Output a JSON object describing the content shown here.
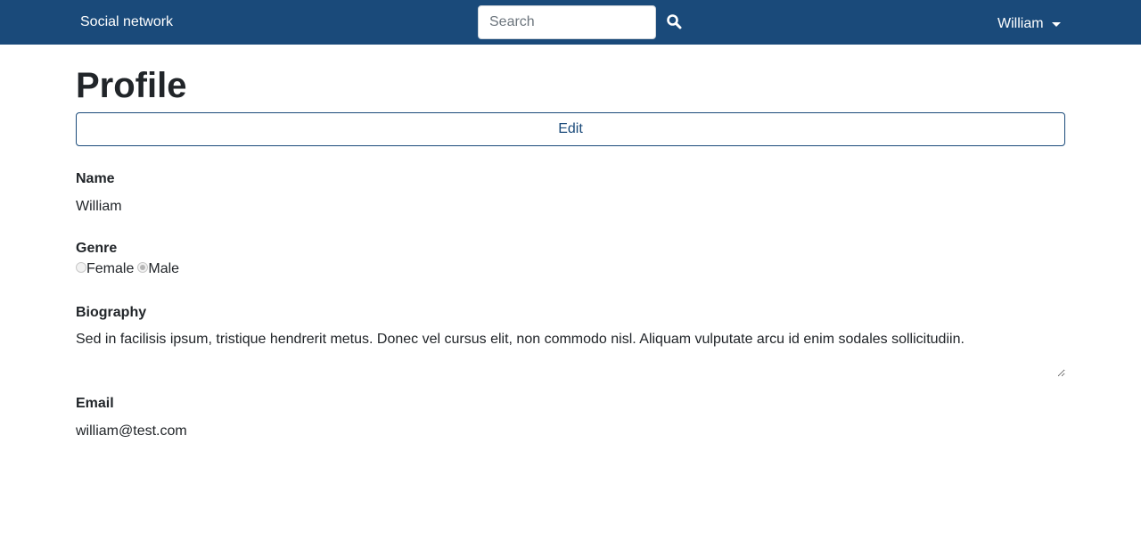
{
  "navbar": {
    "brand": "Social network",
    "search_placeholder": "Search",
    "search_icon": "search-icon",
    "user_name": "William",
    "user_caret_icon": "caret-down-icon",
    "background_color": "#1a4a7a"
  },
  "main": {
    "title": "Profile",
    "edit_label": "Edit",
    "fields": {
      "name": {
        "label": "Name",
        "value": "William"
      },
      "genre": {
        "label": "Genre",
        "options": [
          "Female",
          "Male"
        ],
        "selected": "Male"
      },
      "biography": {
        "label": "Biography",
        "value": "Sed in facilisis ipsum, tristique hendrerit metus. Donec vel cursus elit, non commodo nisl. Aliquam vulputate arcu id enim sodales sollicitudiin."
      },
      "email": {
        "label": "Email",
        "value": "william@test.com"
      }
    }
  }
}
